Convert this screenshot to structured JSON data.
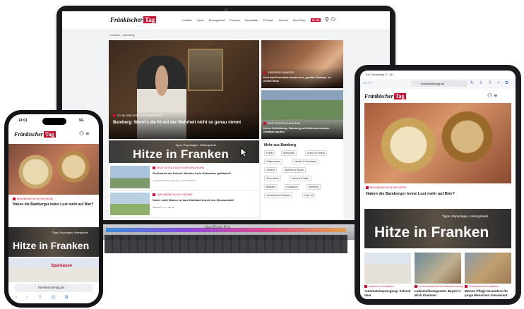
{
  "colors": {
    "brand_red": "#c8102e",
    "ios_blue": "#2a6ee0"
  },
  "brand": {
    "logo_text": "Fränkischer",
    "logo_tag": "Tag"
  },
  "laptop": {
    "nav": [
      "Lokales",
      "Sport",
      "Ebersgeland",
      "Podcast",
      "Newsletter",
      "E-Paper",
      "Service",
      "Abo-Shop"
    ],
    "nav_plus": "PLUS",
    "breadcrumb": "Lokales  >  Bamberg",
    "hero": {
      "kicker": "Zu Bildbildern Hochbeinheit",
      "headline": "Bamberg: Wenn's die KI mit der Wahrheit nicht so genau nimmt"
    },
    "side1": {
      "kicker": "Gebrüder Bamberg",
      "headline": "Erst das Ensemble macht den „großen Gatsby“ zu einem Wow"
    },
    "side2": {
      "kicker": "Rost starten Auer Bam",
      "headline": "Keine Schließung: Bamberg will Ankerwerstraum Gelände kaufen"
    },
    "hitze": {
      "small": "Tipps, Reportagen, Hintergründe",
      "big": "Hitze in Franken"
    },
    "articles": [
      {
        "kicker": "Neue Details nach Durchsuchung",
        "title": "Großrazzia der Polizei: Wurden Auto-Gutachten gefälscht?",
        "meta": "Lichtenfels/Coburg, Bamberg / vor 50 Minuten"
      },
      {
        "kicker": "„Wir waren glück gehabt“",
        "title": "Söder sieht Bilanz: Ist kam Hallstadt durch den Stromausfall",
        "meta": "Hallstadt / vor 1 Stunde"
      }
    ],
    "more": {
      "title": "Mehr aus Bamberg",
      "chips": [
        "Politik",
        "Wirtschaft",
        "Kultur & Freizeit",
        "Gastronomie",
        "Handel & Handwerk",
        "Verkehr",
        "Wohnen & Bauen",
        "Gesundheit",
        "Umwelt & Natur",
        "Blaulicht",
        "Lokalsport",
        "Werbung",
        "Hemmkeiten-Volumen",
        "Uner 12"
      ]
    },
    "base_label": "MacBook Pro"
  },
  "phone": {
    "time": "14:01",
    "signal": "5G",
    "kicker": "Braubranche in der Krise",
    "headline": "Haben die Bamberger keine Lust mehr auf Bier?",
    "hitze": {
      "small": "Tipps, Reportagen, Hintergründe",
      "big": "Hitze in Franken"
    },
    "bottom_sign": "Sparkasse",
    "url": "fraenkischertag.de"
  },
  "tablet": {
    "status": "9:41  Donnerstag 17. Juli",
    "url": "fraenkischertag.de",
    "kicker": "Braubranche in der Krise",
    "headline": "Haben die Bamberger keine Lust mehr auf Bier?",
    "hitze": {
      "small": "Tipps, Reportagen, Hintergründe",
      "big": "Hitze in Franken"
    },
    "cards": [
      {
        "kicker": "Einbruch in Bamberg",
        "title": "Automatensprengung: Schock über"
      },
      {
        "kicker": "Die Bürgerinitiative Gemeinde gegen",
        "title": "Ladenschlussgesetz: Bayern's Wich Klammer"
      },
      {
        "kicker": "Im Gespräch mit Bamberg",
        "title": "Warum Pflege besonders für junge Menschen interessant"
      }
    ]
  }
}
